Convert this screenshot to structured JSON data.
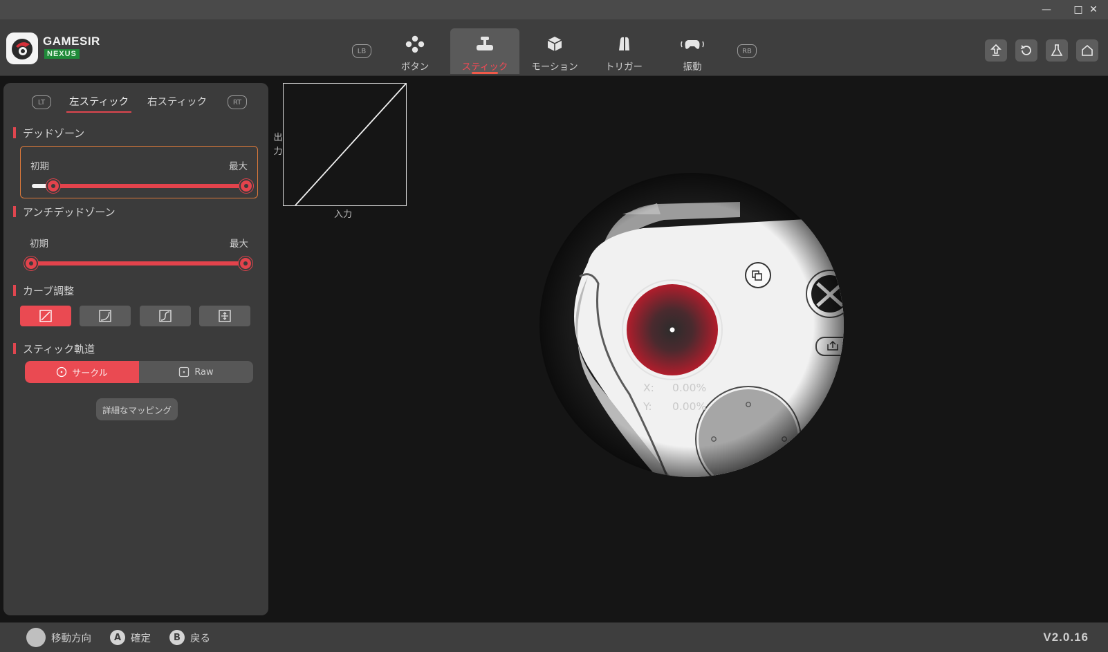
{
  "window": {
    "minimize_glyph": "—",
    "maximize_glyph": "□",
    "close_glyph": "✕"
  },
  "brand": {
    "name_top": "GAMESIR",
    "name_bottom": "NEXUS"
  },
  "nav": {
    "left_bumper": "LB",
    "right_bumper": "RB",
    "tabs": [
      {
        "label": "ボタン",
        "icon": "buttons-icon"
      },
      {
        "label": "スティック",
        "icon": "stick-icon",
        "active": true
      },
      {
        "label": "モーション",
        "icon": "motion-icon"
      },
      {
        "label": "トリガー",
        "icon": "trigger-icon"
      },
      {
        "label": "振動",
        "icon": "vibration-icon"
      }
    ],
    "actions": [
      "upload-icon",
      "reset-icon",
      "flask-icon",
      "home-icon"
    ]
  },
  "panel": {
    "left_trigger": "LT",
    "right_trigger": "RT",
    "tabs": [
      {
        "label": "左スティック",
        "active": true
      },
      {
        "label": "右スティック"
      }
    ],
    "deadzone": {
      "title": "デッドゾーン",
      "min_label": "初期",
      "max_label": "最大",
      "low": 0.1,
      "high": 1.0
    },
    "anti_deadzone": {
      "title": "アンチデッドゾーン",
      "min_label": "初期",
      "max_label": "最大",
      "low": 0.0,
      "high": 1.0
    },
    "curve": {
      "title": "カーブ調整",
      "options": [
        "linear-curve-icon",
        "concave-curve-icon",
        "s-curve-icon",
        "custom-curve-icon"
      ],
      "selected": 0
    },
    "trajectory": {
      "title": "スティック軌道",
      "options": [
        "サークル",
        "Raw"
      ],
      "selected": 0
    },
    "mapping_button": "詳細なマッピング"
  },
  "graph": {
    "y_label": [
      "出",
      "力"
    ],
    "x_label": "入力"
  },
  "readout": {
    "x_key": "X:",
    "x_value": "0.00%",
    "y_key": "Y:",
    "y_value": "0.00%"
  },
  "footer": {
    "hints": [
      {
        "key": "",
        "label": "移動方向"
      },
      {
        "key": "A",
        "label": "確定"
      },
      {
        "key": "B",
        "label": "戻る"
      }
    ],
    "version": "V2.0.16"
  },
  "colors": {
    "accent": "#e3434c",
    "highlight_border": "#e07a3a",
    "background": "#151515",
    "panel": "#3b3b3b"
  }
}
